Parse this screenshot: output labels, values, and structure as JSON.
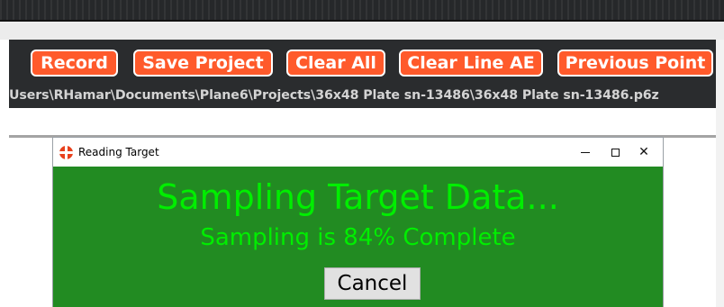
{
  "toolbar": {
    "buttons": [
      "Record",
      "Save Project",
      "Clear All",
      "Clear Line AE",
      "Previous Point"
    ]
  },
  "project_path": "Users\\RHamar\\Documents\\Plane6\\Projects\\36x48 Plate sn-13486\\36x48 Plate sn-13486.p6z",
  "dialog": {
    "title": "Reading Target",
    "heading": "Sampling Target Data...",
    "progress_text": "Sampling is 84% Complete",
    "progress_percent": 84,
    "cancel_label": "Cancel",
    "icon": "crosshair-app-icon"
  },
  "colors": {
    "button_accent": "#ff5a2b",
    "dialog_background": "#228b22",
    "dialog_text": "#00ee00"
  }
}
